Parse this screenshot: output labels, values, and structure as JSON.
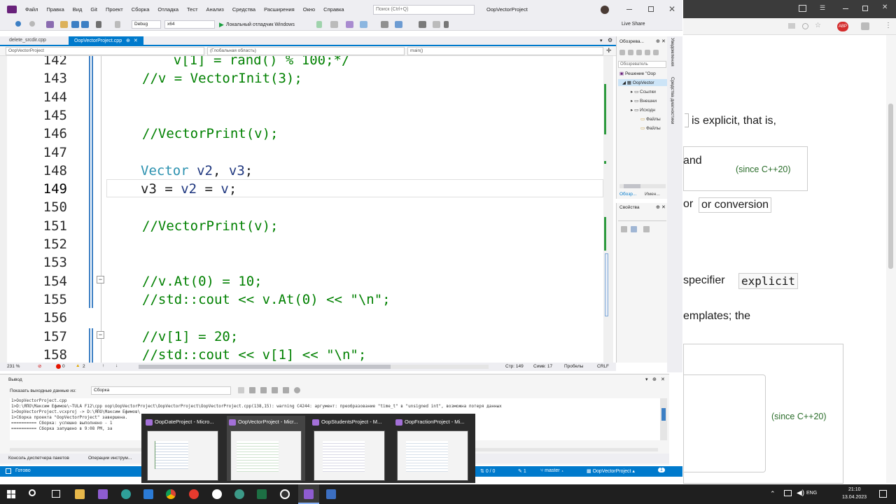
{
  "menu": [
    "Файл",
    "Правка",
    "Вид",
    "Git",
    "Проект",
    "Сборка",
    "Отладка",
    "Тест",
    "Анализ",
    "Средства",
    "Расширения",
    "Окно",
    "Справка"
  ],
  "search": {
    "placeholder": "Поиск (Ctrl+Q)"
  },
  "window_title": "OopVectorProject",
  "toolbar": {
    "config": "Debug",
    "platform": "x64",
    "run_label": "Локальный отладчик Windows",
    "live_share": "Live Share"
  },
  "tabs": [
    {
      "label": "delete_srcdir.cpp",
      "active": false
    },
    {
      "label": "OopVectorProject.cpp",
      "active": true
    }
  ],
  "navbar": {
    "project": "OopVectorProject",
    "scope": "(Глобальная область)",
    "member": "main()"
  },
  "code_lines": [
    {
      "num": "142",
      "text": "    v[1] = rand() % 100;*/",
      "cls": "cm",
      "indent": 1
    },
    {
      "num": "143",
      "text": "//v = VectorInit(3);",
      "cls": "cm",
      "indent": 0
    },
    {
      "num": "144",
      "text": "",
      "cls": "",
      "indent": 0
    },
    {
      "num": "145",
      "text": "",
      "cls": "",
      "indent": 0
    },
    {
      "num": "146",
      "text": "//VectorPrint(v);",
      "cls": "cm",
      "indent": 0
    },
    {
      "num": "147",
      "text": "",
      "cls": "",
      "indent": 0
    },
    {
      "num": "148",
      "text": "Vector v2, v3;",
      "cls": "decl",
      "indent": 0
    },
    {
      "num": "149",
      "text": "v3 = v2 = v;",
      "cls": "assign",
      "indent": 0
    },
    {
      "num": "150",
      "text": "",
      "cls": "",
      "indent": 0
    },
    {
      "num": "151",
      "text": "//VectorPrint(v);",
      "cls": "cm",
      "indent": 0
    },
    {
      "num": "152",
      "text": "",
      "cls": "",
      "indent": 0
    },
    {
      "num": "153",
      "text": "",
      "cls": "",
      "indent": 0
    },
    {
      "num": "154",
      "text": "//v.At(0) = 10;",
      "cls": "cm",
      "indent": 0
    },
    {
      "num": "155",
      "text": "//std::cout << v.At(0) << \"\\n\";",
      "cls": "cm",
      "indent": 0
    },
    {
      "num": "156",
      "text": "",
      "cls": "",
      "indent": 0
    },
    {
      "num": "157",
      "text": "//v[1] = 20;",
      "cls": "cm",
      "indent": 0
    },
    {
      "num": "158",
      "text": "//std::cout << v[1] << \"\\n\";",
      "cls": "cm",
      "indent": 0
    }
  ],
  "solution_panel": {
    "title": "Обозрева...",
    "search": "Обозреватель",
    "root": "Решение \"Оор",
    "project": "OopVector",
    "items": [
      "Ссылки",
      "Внешни",
      "Исходн",
      "Файлы",
      "Файлы"
    ],
    "tabs": [
      "Обозр...",
      "Имен..."
    ]
  },
  "properties_panel": {
    "title": "Свойства"
  },
  "vertical_tabs": [
    "Уведомления",
    "Средства диагностики"
  ],
  "editor_status": {
    "zoom": "231 %",
    "errors": "0",
    "warnings": "2",
    "line": "Стр: 149",
    "col": "Симв: 17",
    "spaces": "Пробелы",
    "eol": "CRLF"
  },
  "output": {
    "title": "Вывод",
    "source_label": "Показать выходные данные из:",
    "source_value": "Сборка",
    "lines": [
      "1>OopVectorProject.cpp",
      "1>D:\\ЯПО\\Максим Ефимов\\~TULA F12\\cpp oop\\OopVectorProject\\OopVectorProject\\OopVectorProject.cpp(138,15): warning C4244: аргумент: преобразование \"time_t\" в \"unsigned int\", возможна потеря данных",
      "1>OopVectorProject.vcxproj -> D:\\ЯПО\\Максим Ефимов\\",
      "1>Сборка проекта \"OopVectorProject\" завершена.",
      "========== Сборка: успешно выполнено - 1",
      "========== Сборка запущено в 9:08 PM, за"
    ]
  },
  "bottom_tabs": [
    "Консоль диспетчера пакетов",
    "Операции инструм..."
  ],
  "vs_status": {
    "ready": "Готово",
    "lines": "0 / 0",
    "pencil": "1",
    "branch": "master",
    "project": "OopVectorProject",
    "notif": "1"
  },
  "browser": {
    "frag1": "is explicit, that is,",
    "frag2": "and",
    "since1": "(since C++20)",
    "frag3a": "or",
    "frag3b": "or conversion",
    "frag4a": "specifier",
    "frag4b": "explicit",
    "frag5": "emplates; the",
    "since2": "(since C++20)",
    "abp": "ABP"
  },
  "thumbnails": [
    {
      "title": "OopDateProject - Micro..."
    },
    {
      "title": "OopVectorProject - Micr..."
    },
    {
      "title": "OopStudentsProject - M..."
    },
    {
      "title": "OopFractionProject - Mi..."
    }
  ],
  "tray": {
    "lang": "ENG",
    "time": "21:10",
    "date": "13.04.2023"
  }
}
